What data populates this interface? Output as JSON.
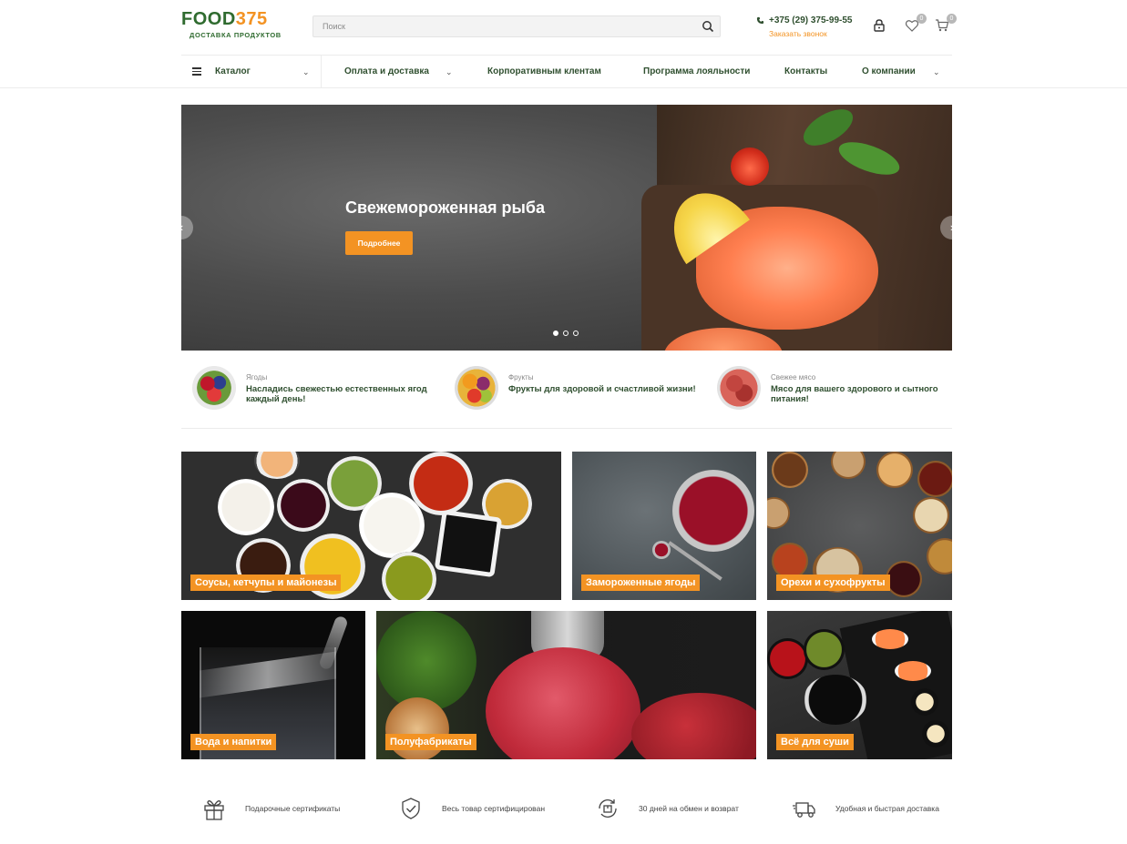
{
  "header": {
    "logo_food": "FOOD",
    "logo_num": "375",
    "logo_sub": "ДОСТАВКА ПРОДУКТОВ",
    "search_placeholder": "Поиск",
    "phone": "+375 (29) 375-99-55",
    "callback": "Заказать звонок",
    "favorites_count": "0",
    "cart_count": "0"
  },
  "nav": {
    "catalog": "Каталог",
    "items": [
      "Оплата и доставка",
      "Корпоративным клентам",
      "Программа лояльности",
      "Контакты",
      "О компании"
    ]
  },
  "hero": {
    "title": "Свежемороженная рыба",
    "button": "Подробнее",
    "slides": 3,
    "active_slide": 1
  },
  "promos": [
    {
      "category": "Ягоды",
      "text": "Насладись свежестью естественных ягод каждый день!"
    },
    {
      "category": "Фрукты",
      "text": "Фрукты для здоровой и счастливой жизни!"
    },
    {
      "category": "Свежее мясо",
      "text": "Мясо для вашего здорового и сытного питания!"
    }
  ],
  "categories": [
    "Соусы, кетчупы и майонезы",
    "Замороженные ягоды",
    "Орехи и сухофрукты",
    "Вода и напитки",
    "Полуфабрикаты",
    "Всё для суши"
  ],
  "features": [
    "Подарочные сертификаты",
    "Весь товар сертифицирован",
    "30 дней на обмен и возврат",
    "Удобная и быстрая доставка"
  ],
  "colors": {
    "accent": "#f39323",
    "brand_green": "#2f6b2f",
    "text_dark": "#2f4f2f"
  }
}
